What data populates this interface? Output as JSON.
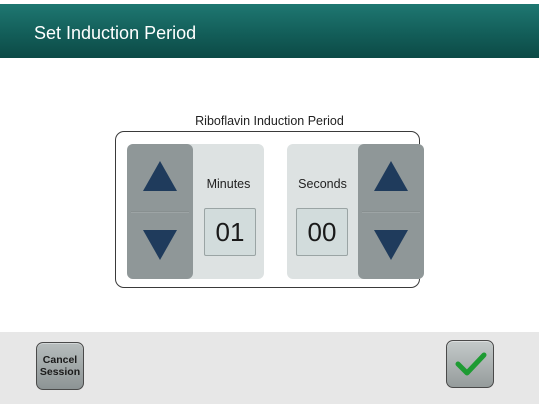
{
  "header": {
    "title": "Set Induction Period"
  },
  "timer_panel": {
    "title": "Riboflavin Induction Period",
    "minutes": {
      "label": "Minutes",
      "value": "01"
    },
    "seconds": {
      "label": "Seconds",
      "value": "00"
    }
  },
  "footer": {
    "cancel_label_line1": "Cancel",
    "cancel_label_line2": "Session"
  },
  "icons": {
    "increment": "triangle-up-icon",
    "decrement": "triangle-down-icon",
    "confirm": "checkmark-icon"
  },
  "colors": {
    "header": "#135e59",
    "arrow": "#1f3b5c",
    "checkmark": "#1e9b33"
  }
}
